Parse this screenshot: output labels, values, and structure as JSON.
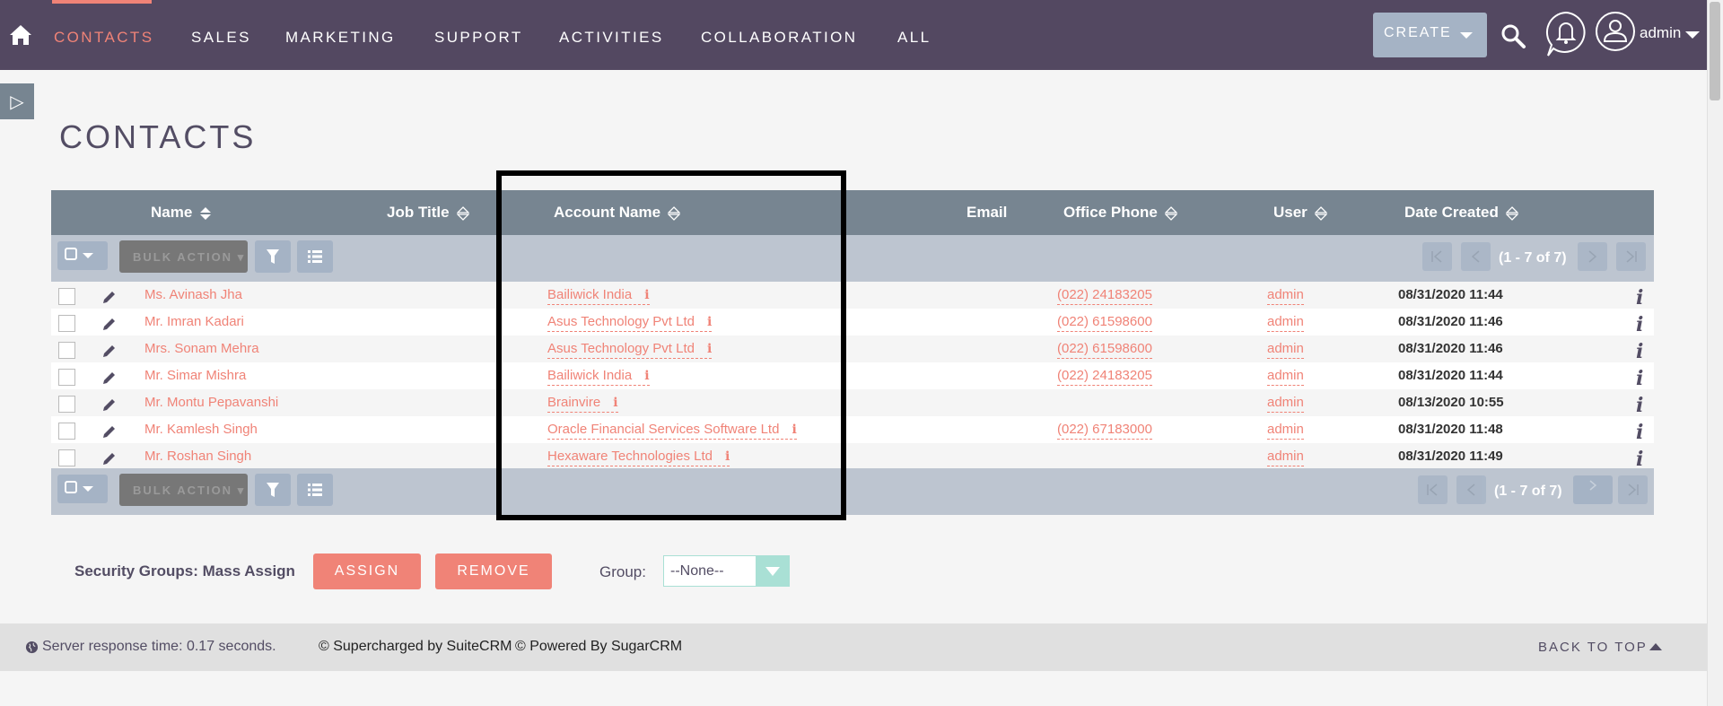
{
  "nav": {
    "tabs": [
      "CONTACTS",
      "SALES",
      "MARKETING",
      "SUPPORT",
      "ACTIVITIES",
      "COLLABORATION",
      "ALL"
    ],
    "active_tab": "CONTACTS",
    "create_label": "CREATE",
    "user_name": "admin"
  },
  "page": {
    "title": "CONTACTS"
  },
  "table": {
    "headers": {
      "name": "Name",
      "job_title": "Job Title",
      "account_name": "Account Name",
      "email": "Email",
      "office_phone": "Office Phone",
      "user": "User",
      "date_created": "Date Created"
    },
    "bulk_action": "BULK ACTION",
    "pagination": "(1 - 7 of 7)",
    "info_glyph": "i",
    "rows": [
      {
        "name": "Ms. Avinash Jha",
        "account": "Bailiwick India",
        "phone": "(022) 24183205",
        "user": "admin",
        "date": "08/31/2020 11:44"
      },
      {
        "name": "Mr. Imran Kadari",
        "account": "Asus Technology Pvt Ltd",
        "phone": "(022) 61598600",
        "user": "admin",
        "date": "08/31/2020 11:46"
      },
      {
        "name": "Mrs. Sonam Mehra",
        "account": "Asus Technology Pvt Ltd",
        "phone": "(022) 61598600",
        "user": "admin",
        "date": "08/31/2020 11:46"
      },
      {
        "name": "Mr. Simar Mishra",
        "account": "Bailiwick India",
        "phone": "(022) 24183205",
        "user": "admin",
        "date": "08/31/2020 11:44"
      },
      {
        "name": "Mr. Montu Pepavanshi",
        "account": "Brainvire",
        "phone": "",
        "user": "admin",
        "date": "08/13/2020 10:55"
      },
      {
        "name": "Mr. Kamlesh Singh",
        "account": "Oracle Financial Services Software Ltd",
        "phone": "(022) 67183000",
        "user": "admin",
        "date": "08/31/2020 11:48"
      },
      {
        "name": "Mr. Roshan Singh",
        "account": "Hexaware Technologies Ltd",
        "phone": "",
        "user": "admin",
        "date": "08/31/2020 11:49"
      }
    ]
  },
  "security_groups": {
    "label": "Security Groups: Mass Assign",
    "assign": "ASSIGN",
    "remove": "REMOVE",
    "group_label": "Group:",
    "group_value": "--None--"
  },
  "footer": {
    "response_time": "Server response time: 0.17 seconds.",
    "suitecrm": "© Supercharged by SuiteCRM",
    "sugarcrm": "© Powered By SugarCRM",
    "back_to_top": "BACK TO TOP"
  },
  "colors": {
    "nav_bg": "#534861",
    "accent": "#f08377",
    "table_header": "#778591",
    "pager_bg": "#bdc5d0",
    "button_blue": "#a5b3c5"
  }
}
